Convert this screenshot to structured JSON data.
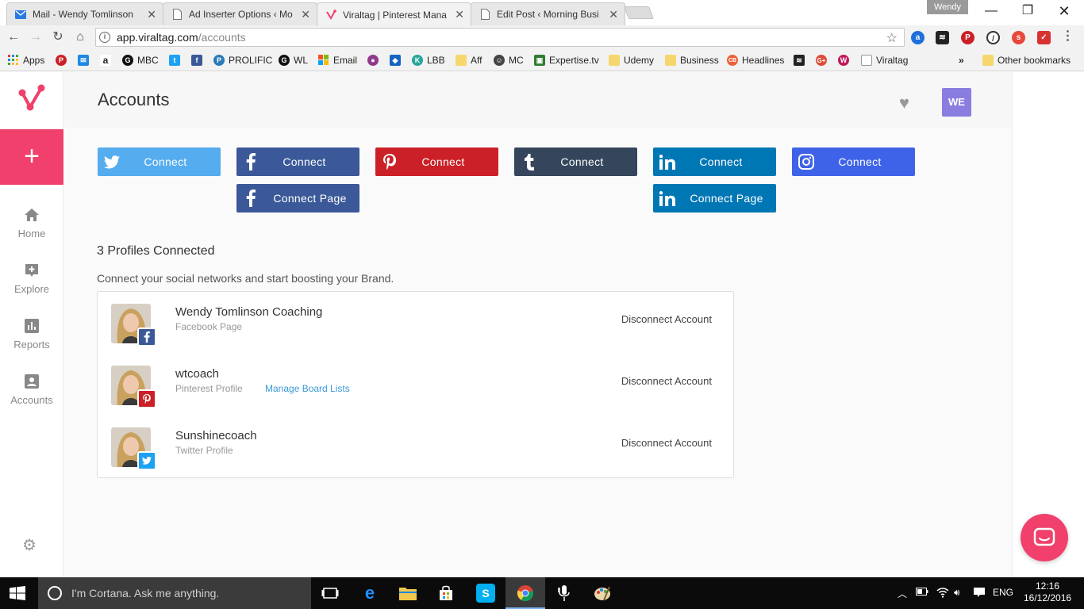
{
  "browser": {
    "tabs": [
      {
        "title": "Mail - Wendy Tomlinson",
        "icon": "mail-icon",
        "active": false
      },
      {
        "title": "Ad Inserter Options ‹ Mo",
        "icon": "page-icon",
        "active": false
      },
      {
        "title": "Viraltag | Pinterest Mana",
        "icon": "viraltag-icon",
        "active": true
      },
      {
        "title": "Edit Post ‹ Morning Busi",
        "icon": "page-icon",
        "active": false
      }
    ],
    "profile_name": "Wendy",
    "url_host": "app.viraltag.com",
    "url_path": "/accounts",
    "bookmarks": [
      {
        "label": "Apps",
        "icon": "apps-grid-icon",
        "color": "#4285f4"
      },
      {
        "label": "",
        "icon": "pinterest-icon",
        "color": "#cb2027"
      },
      {
        "label": "",
        "icon": "mail-icon",
        "color": "#1e88e5"
      },
      {
        "label": "",
        "icon": "amazon-icon",
        "color": "#222222"
      },
      {
        "label": "MBC",
        "icon": "g-icon",
        "color": "#111111"
      },
      {
        "label": "",
        "icon": "twitter-icon",
        "color": "#1da1f2"
      },
      {
        "label": "",
        "icon": "facebook-icon",
        "color": "#3b5998"
      },
      {
        "label": "PROLIFIC",
        "icon": "prolific-icon",
        "color": "#2a7ab8"
      },
      {
        "label": "WL",
        "icon": "g-icon",
        "color": "#111111"
      },
      {
        "label": "Email",
        "icon": "windows-icon",
        "color": "#f25022"
      },
      {
        "label": "",
        "icon": "circle-icon",
        "color": "#8e3a8e"
      },
      {
        "label": "",
        "icon": "shield-icon",
        "color": "#1565c0"
      },
      {
        "label": "LBB",
        "icon": "k-icon",
        "color": "#26a69a"
      },
      {
        "label": "Aff",
        "icon": "folder-icon",
        "color": "#f5d76e"
      },
      {
        "label": "MC",
        "icon": "person-icon",
        "color": "#444444"
      },
      {
        "label": "Expertise.tv",
        "icon": "tv-icon",
        "color": "#2e7d32"
      },
      {
        "label": "Udemy",
        "icon": "folder-icon",
        "color": "#f5d76e"
      },
      {
        "label": "Business",
        "icon": "folder-icon",
        "color": "#f5d76e"
      },
      {
        "label": "Headlines",
        "icon": "cb-icon",
        "color": "#e8633a"
      },
      {
        "label": "",
        "icon": "buffer-icon",
        "color": "#222222"
      },
      {
        "label": "",
        "icon": "gplus-icon",
        "color": "#dd4b39"
      },
      {
        "label": "",
        "icon": "w-icon",
        "color": "#c2185b"
      },
      {
        "label": "Viraltag",
        "icon": "page-icon",
        "color": "#999999"
      }
    ],
    "other_bookmarks": "Other bookmarks"
  },
  "app": {
    "page_title": "Accounts",
    "user_initials": "WE",
    "brand_color": "#f0406b",
    "sidebar": [
      {
        "label": "Home",
        "icon": "home-icon"
      },
      {
        "label": "Explore",
        "icon": "explore-icon"
      },
      {
        "label": "Reports",
        "icon": "reports-icon"
      },
      {
        "label": "Accounts",
        "icon": "accounts-icon"
      }
    ],
    "connect_buttons": [
      {
        "network": "twitter",
        "label": "Connect",
        "color": "#55acee"
      },
      {
        "network": "facebook",
        "label": "Connect",
        "color": "#3b5998"
      },
      {
        "network": "pinterest",
        "label": "Connect",
        "color": "#cb2027"
      },
      {
        "network": "tumblr",
        "label": "Connect",
        "color": "#35465c"
      },
      {
        "network": "linkedin",
        "label": "Connect",
        "color": "#0077b5"
      },
      {
        "network": "instagram",
        "label": "Connect",
        "color": "#3f63e8"
      },
      {
        "network": "facebook-page",
        "label": "Connect Page",
        "color": "#3b5998"
      },
      {
        "network": "linkedin-page",
        "label": "Connect Page",
        "color": "#0077b5"
      }
    ],
    "profiles_count_text": "3 Profiles Connected",
    "profiles_subtitle": "Connect your social networks and start boosting your Brand.",
    "profiles": [
      {
        "name": "Wendy Tomlinson Coaching",
        "type": "Facebook Page",
        "network": "facebook",
        "manage": "",
        "action": "Disconnect Account"
      },
      {
        "name": "wtcoach",
        "type": "Pinterest Profile",
        "network": "pinterest",
        "manage": "Manage Board Lists",
        "action": "Disconnect Account"
      },
      {
        "name": "Sunshinecoach",
        "type": "Twitter Profile",
        "network": "twitter",
        "manage": "",
        "action": "Disconnect Account"
      }
    ]
  },
  "taskbar": {
    "search_placeholder": "I'm Cortana. Ask me anything.",
    "language": "ENG",
    "time": "12:16",
    "date": "16/12/2016"
  }
}
